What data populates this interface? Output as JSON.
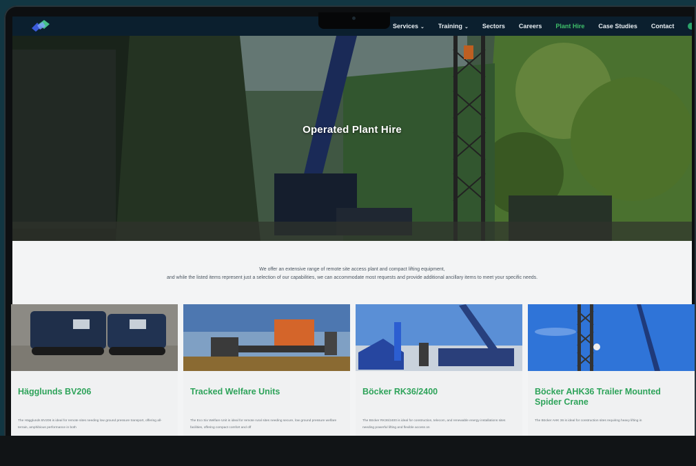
{
  "nav": {
    "items": [
      {
        "label": "Services",
        "dropdown": true
      },
      {
        "label": "Training",
        "dropdown": true
      },
      {
        "label": "Sectors",
        "dropdown": false
      },
      {
        "label": "Careers",
        "dropdown": false
      },
      {
        "label": "Plant Hire",
        "dropdown": false,
        "active": true
      },
      {
        "label": "Case Studies",
        "dropdown": false
      },
      {
        "label": "Contact",
        "dropdown": false
      }
    ],
    "chevron": "⌄",
    "language_chevron": "⌄"
  },
  "hero": {
    "title": "Operated Plant Hire"
  },
  "intro": {
    "line1": "We offer an extensive range of remote site access plant and compact lifting equipment,",
    "line2": "and while the listed items represent just a selection of our capabilities, we can accommodate most requests and provide additional ancillary items to meet your specific needs."
  },
  "cards": [
    {
      "title": "Hägglunds BV206",
      "desc": "The Hägglunds BV206 is ideal for remote sites needing low ground pressure transport, offering all-terrain, amphibious performance in both"
    },
    {
      "title": "Tracked Welfare Units",
      "desc": "The Eco Six Welfare Unit is ideal for remote rural sites needing secure, low ground pressure welfare facilities, offering compact comfort and off"
    },
    {
      "title": "Böcker RK36/2400",
      "desc": "The Böcker RK36/2400 is ideal for construction, telecom, and renewable energy installations sites needing powerful lifting and flexible access on"
    },
    {
      "title": "Böcker AHK36 Trailer Mounted Spider Crane",
      "desc": "The Böcker AHK 36 is ideal for construction sites requiring heavy lifting in"
    }
  ],
  "colors": {
    "nav_bg": "#0b1f2e",
    "accent": "#2ea35a",
    "active_nav": "#3fbf6a"
  }
}
